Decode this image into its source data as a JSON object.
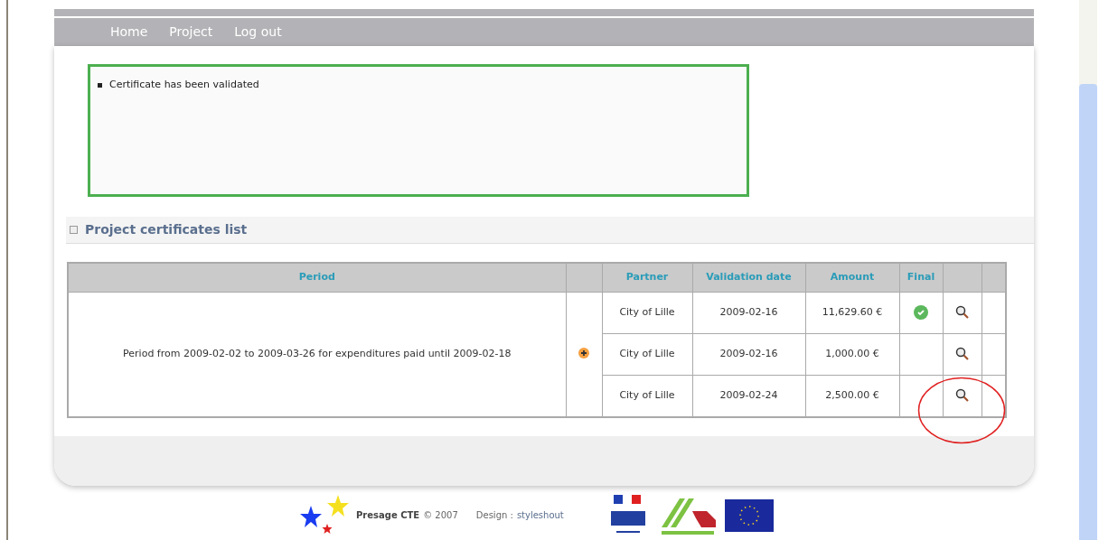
{
  "nav": {
    "items": [
      {
        "label": "Home"
      },
      {
        "label": "Project"
      },
      {
        "label": "Log out"
      }
    ]
  },
  "message": {
    "text": "Certificate has been validated"
  },
  "section": {
    "title": "Project certificates list"
  },
  "table": {
    "columns": [
      "Period",
      "",
      "Partner",
      "Validation date",
      "Amount",
      "Final",
      "",
      ""
    ],
    "period": "Period from 2009-02-02 to 2009-03-26 for expenditures paid until 2009-02-18",
    "rows": [
      {
        "partner": "City of Lille",
        "date": "2009-02-16",
        "amount": "11,629.60 €",
        "final": true
      },
      {
        "partner": "City of Lille",
        "date": "2009-02-16",
        "amount": "1,000.00 €",
        "final": false
      },
      {
        "partner": "City of Lille",
        "date": "2009-02-24",
        "amount": "2,500.00 €",
        "final": false
      }
    ]
  },
  "footer": {
    "brand": "Presage CTE",
    "copyright": "© 2007",
    "design_label": "Design :",
    "design_link": "styleshout"
  }
}
